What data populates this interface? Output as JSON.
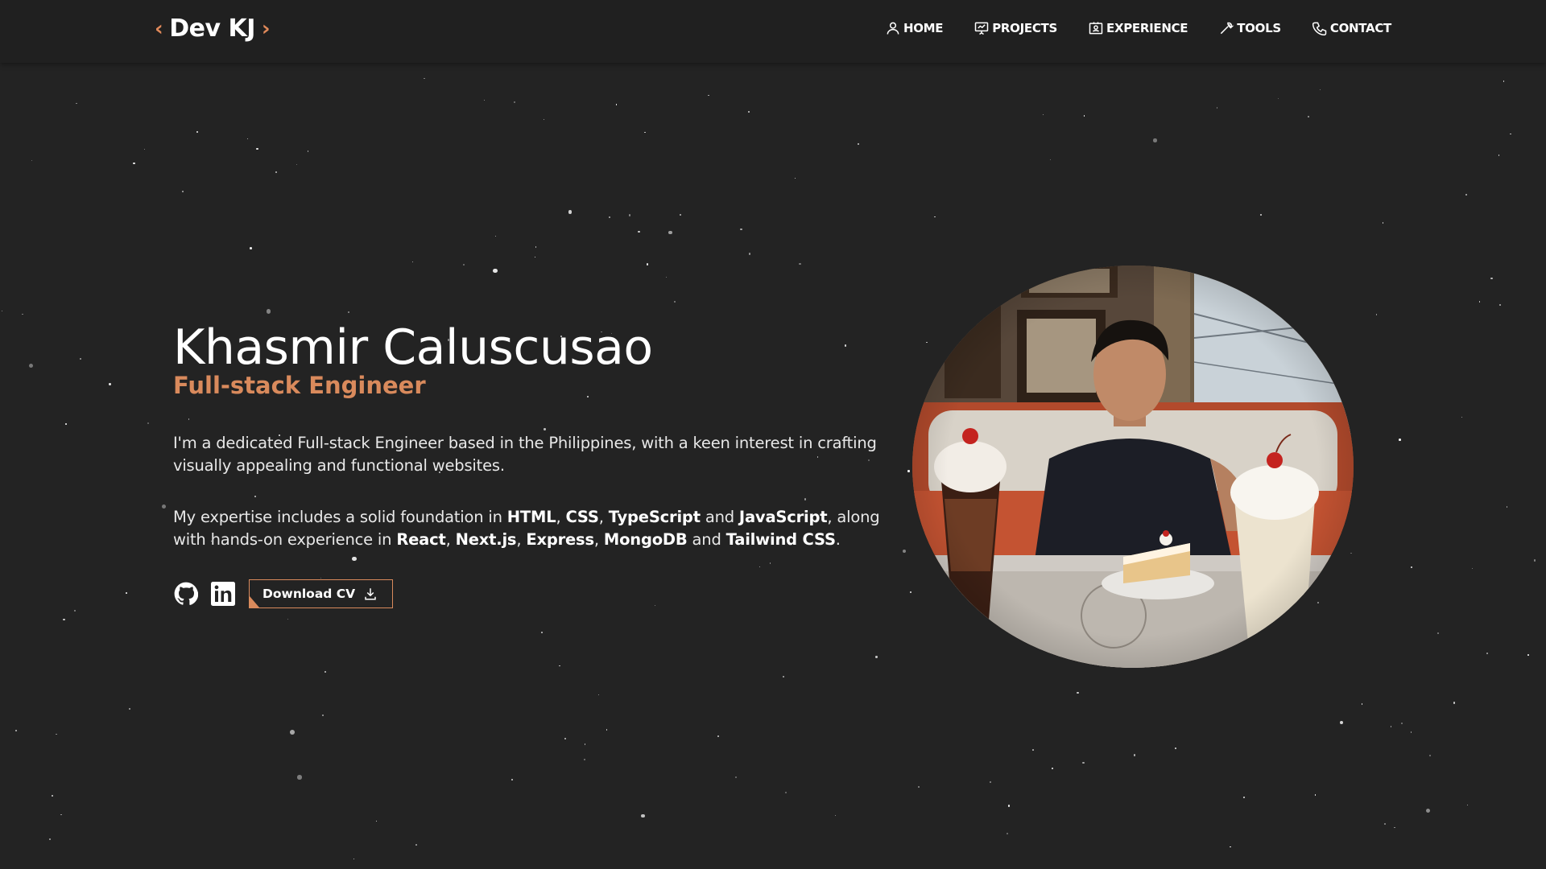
{
  "nav": {
    "logo_text": "Dev KJ",
    "logo_left": "‹",
    "logo_right": "›",
    "links": [
      {
        "label": "HOME",
        "icon": "user-icon"
      },
      {
        "label": "PROJECTS",
        "icon": "presentation-chart-icon"
      },
      {
        "label": "EXPERIENCE",
        "icon": "id-badge-icon"
      },
      {
        "label": "TOOLS",
        "icon": "wrench-icon"
      },
      {
        "label": "CONTACT",
        "icon": "phone-icon"
      }
    ]
  },
  "hero": {
    "name": "Khasmir Caluscusao",
    "role": "Full-stack Engineer",
    "intro": "I'm a dedicated Full-stack Engineer based in the Philippines, with a keen interest in crafting visually appealing and functional websites.",
    "expertise": {
      "t0": "My expertise includes a solid foundation in ",
      "b0": "HTML",
      "t1": ", ",
      "b1": "CSS",
      "t2": ", ",
      "b2": "TypeScript",
      "t3": " and ",
      "b3": "JavaScript",
      "t4": ", along with hands-on experience in ",
      "b4": "React",
      "t5": ", ",
      "b5": "Next.js",
      "t6": ", ",
      "b6": "Express",
      "t7": ", ",
      "b7": "MongoDB",
      "t8": " and ",
      "b8": "Tailwind CSS",
      "t9": "."
    },
    "socials": [
      {
        "icon": "github-icon"
      },
      {
        "icon": "linkedin-icon"
      }
    ],
    "cv_button": "Download CV",
    "cv_icon": "download-icon"
  },
  "colors": {
    "background": "#232323",
    "navbar": "#202020",
    "accent": "#d98a5c",
    "text": "#ffffff"
  }
}
